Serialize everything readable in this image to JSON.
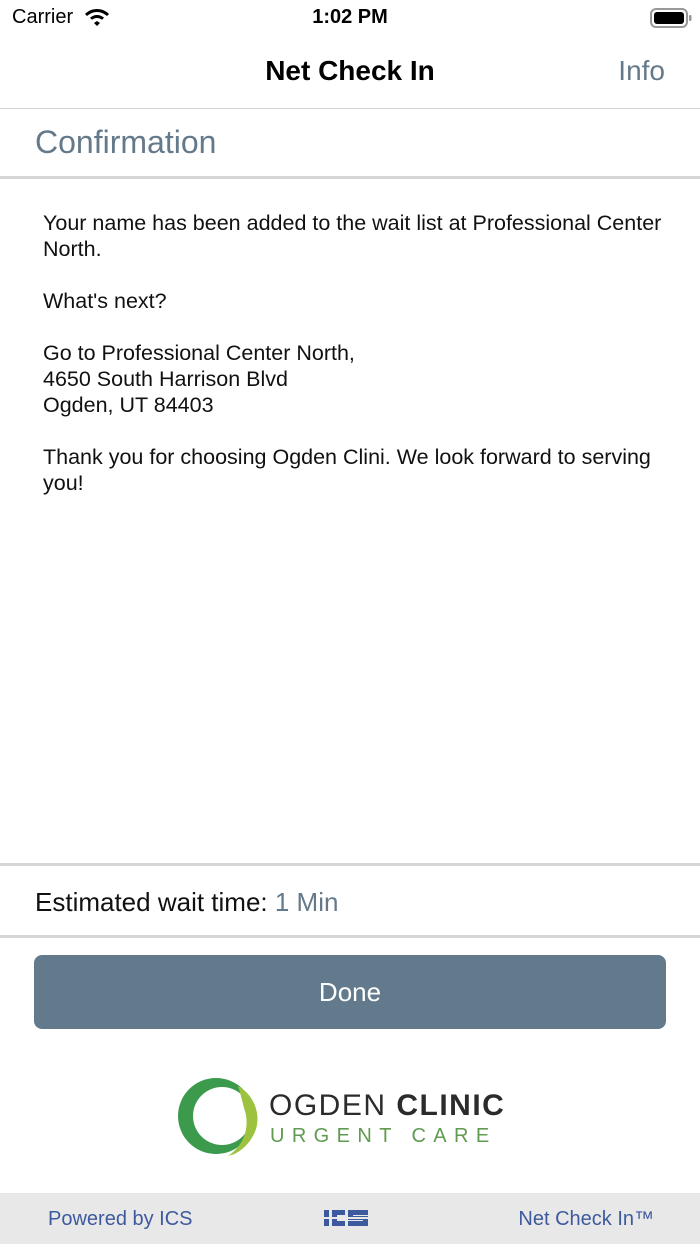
{
  "status_bar": {
    "carrier": "Carrier",
    "time": "1:02 PM"
  },
  "nav": {
    "title": "Net Check In",
    "info_label": "Info"
  },
  "section_title": "Confirmation",
  "message": {
    "added": "Your name has been added to the wait list at Professional Center North.",
    "whats_next": "What's next?",
    "address_line1": "Go to Professional Center North,",
    "address_line2": "4650 South Harrison Blvd",
    "address_line3": "Ogden, UT 84403",
    "thanks": "Thank you for choosing Ogden Clini. We look forward to serving you!"
  },
  "wait": {
    "label": "Estimated wait time:",
    "value": "1 Min"
  },
  "done_label": "Done",
  "logo": {
    "name_light": "OGDEN",
    "name_bold": "CLINIC",
    "subtitle": "URGENT CARE"
  },
  "footer": {
    "powered_by": "Powered by ICS",
    "product": "Net Check In™"
  },
  "colors": {
    "accent": "#64798a",
    "button": "#627a8b",
    "footer_link": "#3d5a9e",
    "logo_green": "#5f9b50"
  }
}
